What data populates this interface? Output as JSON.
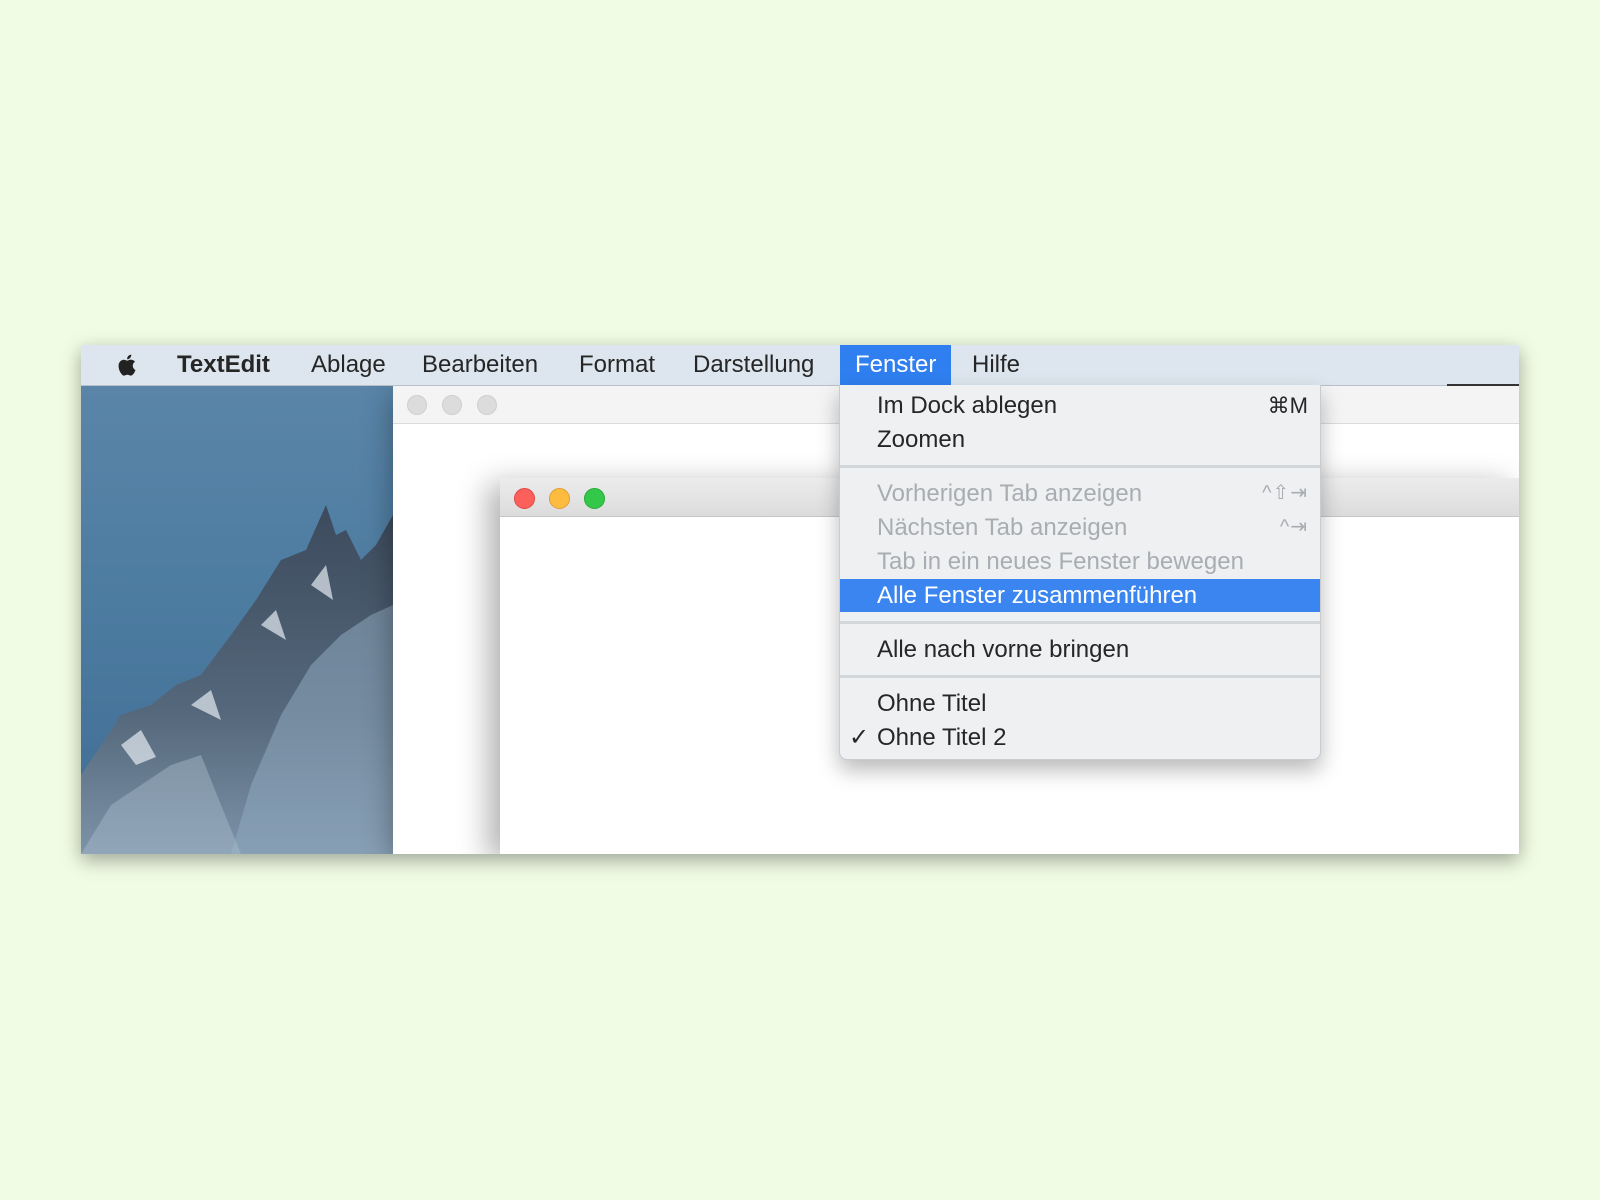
{
  "menubar": {
    "apple_icon": "apple-logo-icon",
    "app_name": "TextEdit",
    "items": [
      "Ablage",
      "Bearbeiten",
      "Format",
      "Darstellung",
      "Fenster",
      "Hilfe"
    ],
    "active": "Fenster"
  },
  "fenster_menu": {
    "dock": {
      "label": "Im Dock ablegen",
      "shortcut": "⌘M"
    },
    "zoom": {
      "label": "Zoomen"
    },
    "prev_tab": {
      "label": "Vorherigen Tab anzeigen",
      "shortcut": "^⇧⇥"
    },
    "next_tab": {
      "label": "Nächsten Tab anzeigen",
      "shortcut": "^⇥"
    },
    "move_tab": {
      "label": "Tab in ein neues Fenster bewegen"
    },
    "merge": {
      "label": "Alle Fenster zusammenführen"
    },
    "bring_front": {
      "label": "Alle nach vorne bringen"
    },
    "win1": {
      "label": "Ohne Titel"
    },
    "win2": {
      "label": "Ohne Titel 2",
      "check": "✓"
    }
  },
  "colors": {
    "page_background": "#f0fce4",
    "menu_highlight": "#3a85f0",
    "close": "#fc605b",
    "minimize": "#fdbc40",
    "zoom": "#34c84a"
  }
}
